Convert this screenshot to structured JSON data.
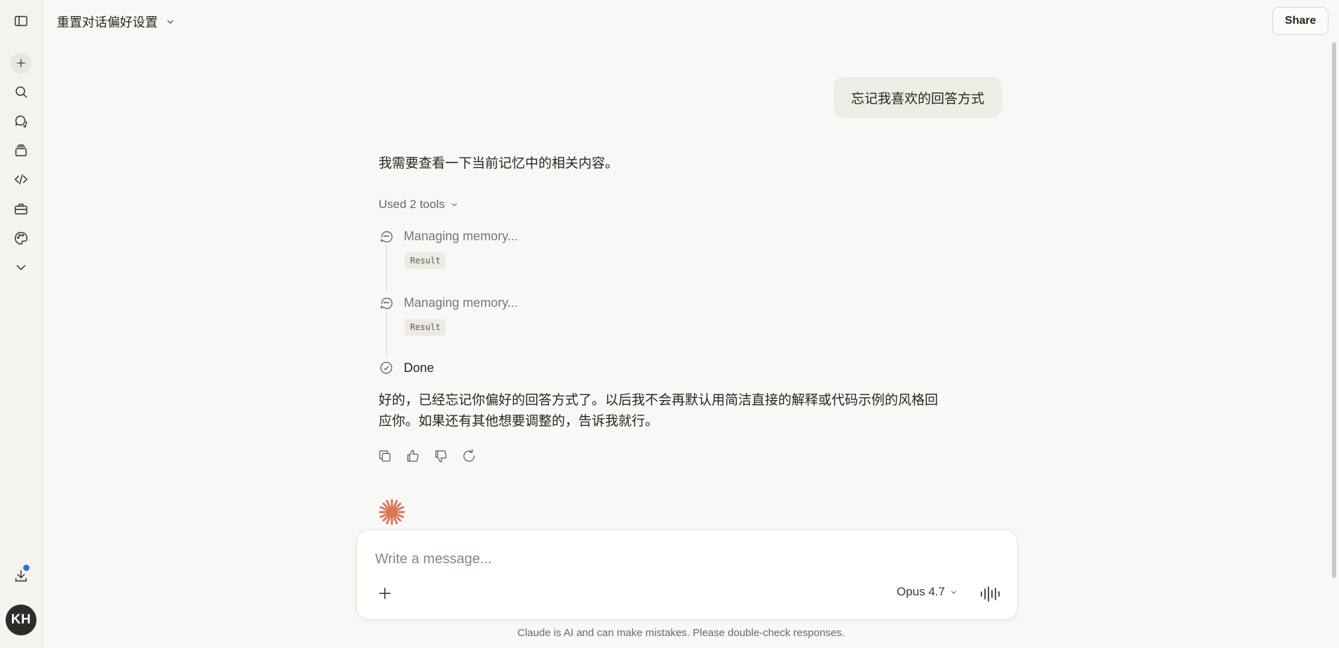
{
  "header": {
    "title": "重置对话偏好设置",
    "share_label": "Share"
  },
  "sidebar": {
    "items": [
      {
        "name": "toggle-sidebar",
        "icon": "sidebar-icon"
      },
      {
        "name": "new-chat",
        "icon": "plus-icon"
      },
      {
        "name": "search",
        "icon": "search-icon"
      },
      {
        "name": "chats",
        "icon": "chat-bubbles-icon"
      },
      {
        "name": "projects",
        "icon": "stack-icon"
      },
      {
        "name": "code",
        "icon": "code-icon"
      },
      {
        "name": "tools",
        "icon": "toolbox-icon"
      },
      {
        "name": "artifacts",
        "icon": "palette-icon"
      },
      {
        "name": "more",
        "icon": "chevron-down-icon"
      }
    ],
    "download_icon": "download-icon",
    "avatar_initials": "KH"
  },
  "conversation": {
    "user_message": "忘记我喜欢的回答方式",
    "assistant_intro": "我需要查看一下当前记忆中的相关内容。",
    "used_tools_label": "Used 2 tools",
    "tool_calls": [
      {
        "label": "Managing memory...",
        "result_label": "Result"
      },
      {
        "label": "Managing memory...",
        "result_label": "Result"
      }
    ],
    "done_label": "Done",
    "assistant_reply_line1": "好的，已经忘记你偏好的回答方式了。以后我不会再默认用简洁直接的解释或代码示例的风格回",
    "assistant_reply_line2": "应你。如果还有其他想要调整的，告诉我就行。"
  },
  "composer": {
    "placeholder": "Write a message...",
    "model_label": "Opus 4.7"
  },
  "footer": {
    "disclaimer": "Claude is AI and can make mistakes. Please double-check responses."
  },
  "colors": {
    "background": "#f8f8f6",
    "brand_logo": "#d97757",
    "notification_dot": "#2b6fe0"
  }
}
